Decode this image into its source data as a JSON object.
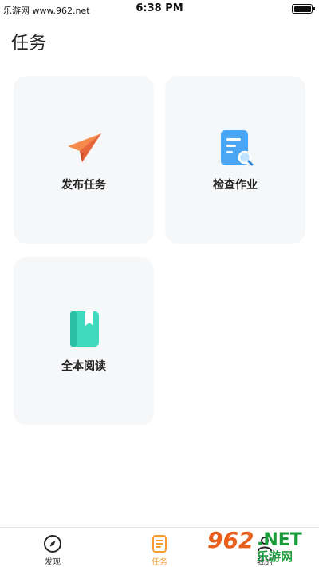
{
  "status_bar": {
    "left_text": "乐游网 www.962.net",
    "time": "6:38 PM"
  },
  "page": {
    "title": "任务"
  },
  "cards": [
    {
      "label": "发布任务",
      "icon": "paper-plane-icon"
    },
    {
      "label": "检查作业",
      "icon": "document-search-icon"
    },
    {
      "label": "全本阅读",
      "icon": "book-icon"
    }
  ],
  "tabbar": {
    "items": [
      {
        "label": "发现",
        "icon": "compass-icon",
        "active": false
      },
      {
        "label": "任务",
        "icon": "task-list-icon",
        "active": true
      },
      {
        "label": "我的",
        "icon": "profile-icon",
        "active": false
      }
    ],
    "active_color": "#f39b2e"
  },
  "watermark": {
    "digits": "962",
    "suffix": ".NET",
    "name": "乐游网"
  },
  "colors": {
    "card_bg": "#f6f7f9",
    "plane_orange": "#f0743a",
    "doc_blue": "#4aa6f5",
    "book_teal": "#3fd9c0"
  }
}
